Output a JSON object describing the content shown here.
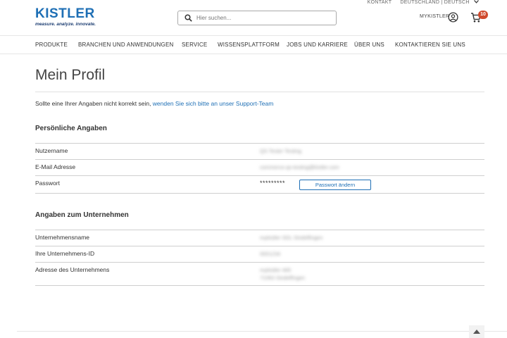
{
  "topbar": {
    "contact": "KONTAKT",
    "language": "DEUTSCHLAND | DEUTSCH"
  },
  "logo": {
    "word": "KISTLER",
    "tagline": "measure. analyze. innovate."
  },
  "search": {
    "placeholder": "Hier suchen..."
  },
  "header": {
    "mykistler_label": "MYKISTLER",
    "cart_count": "10"
  },
  "nav": {
    "items": [
      "PRODUKTE",
      "BRANCHEN UND ANWENDUNGEN",
      "SERVICE",
      "WISSENSPLATTFORM",
      "JOBS UND KARRIERE",
      "ÜBER UNS",
      "KONTAKTIEREN SIE UNS"
    ]
  },
  "page": {
    "title": "Mein Profil",
    "intro_text": "Sollte eine Ihrer Angaben nicht korrekt sein, ",
    "intro_link": "wenden Sie sich bitte an unser Support-Team"
  },
  "personal": {
    "heading": "Persönliche Angaben",
    "rows": [
      {
        "label": "Nutzername",
        "value": "QS Tester Testing"
      },
      {
        "label": "E-Mail Adresse",
        "value": "commerce.qs-testing@kistler.com"
      },
      {
        "label": "Passwort",
        "value": "*********"
      }
    ],
    "change_password_label": "Passwort ändern"
  },
  "company": {
    "heading": "Angaben zum Unternehmen",
    "rows": [
      {
        "label": "Unternehmensname",
        "value": "mykistler SDL Sindelfingen"
      },
      {
        "label": "Ihre Unternehmens-ID",
        "value": "0001234"
      },
      {
        "label": "Adresse des Unternehmens",
        "value": "mykistler 465",
        "value2": "71063 Sindelfingen"
      }
    ]
  },
  "colors": {
    "brand_blue": "#1e6fb5",
    "badge": "#d04a2d"
  },
  "icons": [
    "search-icon",
    "user-circle-icon",
    "cart-icon",
    "chevron-down-icon",
    "chevron-up-icon"
  ]
}
